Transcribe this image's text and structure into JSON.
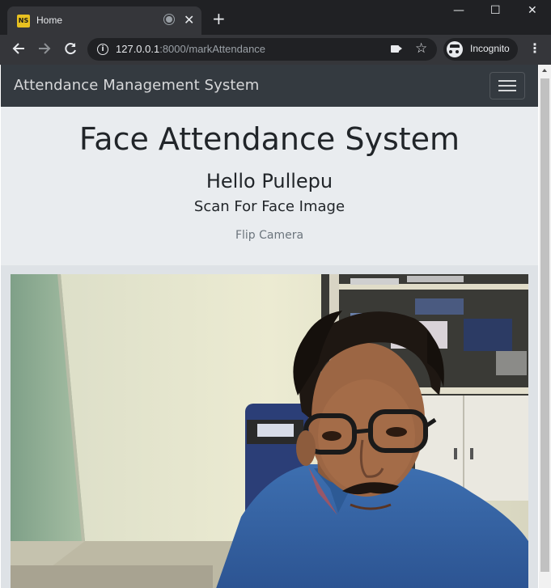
{
  "browser": {
    "tab_title": "Home",
    "favicon_text": "NS",
    "new_tab_symbol": "+",
    "close_tab_symbol": "✕",
    "url_host": "127.0.0.1",
    "url_rest": ":8000/markAttendance",
    "incognito_label": "Incognito",
    "window_controls": {
      "minimize": "—",
      "maximize": "☐",
      "close": "✕"
    },
    "icons": [
      "back-arrow-icon",
      "forward-arrow-icon",
      "reload-icon",
      "info-icon",
      "camera-icon",
      "star-icon",
      "incognito-icon",
      "menu-dots-icon"
    ]
  },
  "navbar": {
    "brand": "Attendance Management System"
  },
  "jumbotron": {
    "title": "Face Attendance System",
    "greeting": "Hello Pullepu",
    "subtitle": "Scan For Face Image",
    "flip_camera": "Flip Camera"
  },
  "colors": {
    "navbar_bg": "#343a40",
    "jumbotron_bg": "#e9ecef",
    "browser_bg": "#202124",
    "toolbar_bg": "#35363a"
  }
}
